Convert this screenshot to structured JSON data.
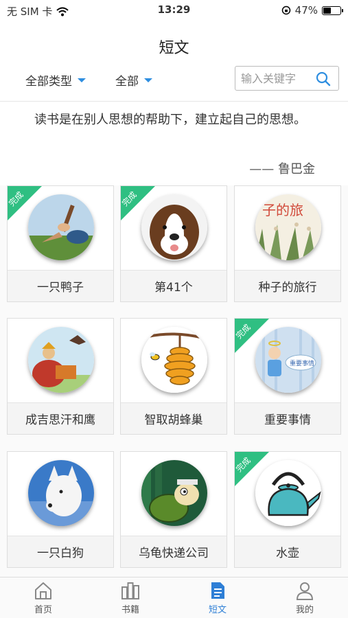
{
  "status_bar": {
    "carrier": "无 SIM 卡",
    "time": "13:29",
    "battery": "47%",
    "battery_level": 0.47
  },
  "nav": {
    "title": "短文"
  },
  "filters": {
    "type_label": "全部类型",
    "scope_label": "全部"
  },
  "search": {
    "placeholder": "输入关键字"
  },
  "quote": {
    "text": "读书是在别人思想的帮助下，建立起自己的思想。",
    "author": "—— 鲁巴金"
  },
  "badge_done": "完成",
  "cards": [
    {
      "title": "一只鸭子",
      "done": true,
      "icon": "slingshot-image"
    },
    {
      "title": "第41个",
      "done": true,
      "icon": "dog-image"
    },
    {
      "title": "种子的旅行",
      "done": false,
      "icon": "seed-travel-image",
      "cover_text": "子的旅"
    },
    {
      "title": "成吉思汗和鹰",
      "done": false,
      "icon": "genghis-eagle-image"
    },
    {
      "title": "智取胡蜂巢",
      "done": false,
      "icon": "beehive-image"
    },
    {
      "title": "重要事情",
      "done": true,
      "icon": "angel-image",
      "cover_text": "重要事情"
    },
    {
      "title": "一只白狗",
      "done": false,
      "icon": "white-dog-image"
    },
    {
      "title": "乌龟快递公司",
      "done": false,
      "icon": "turtle-image"
    },
    {
      "title": "水壶",
      "done": true,
      "icon": "kettle-image"
    }
  ],
  "tabs": [
    {
      "label": "首页",
      "icon": "home-icon",
      "active": false
    },
    {
      "label": "书籍",
      "icon": "books-icon",
      "active": false
    },
    {
      "label": "短文",
      "icon": "document-icon",
      "active": true
    },
    {
      "label": "我的",
      "icon": "user-icon",
      "active": false
    }
  ],
  "colors": {
    "accent": "#2e7fd6",
    "badge": "#2fbf82"
  }
}
